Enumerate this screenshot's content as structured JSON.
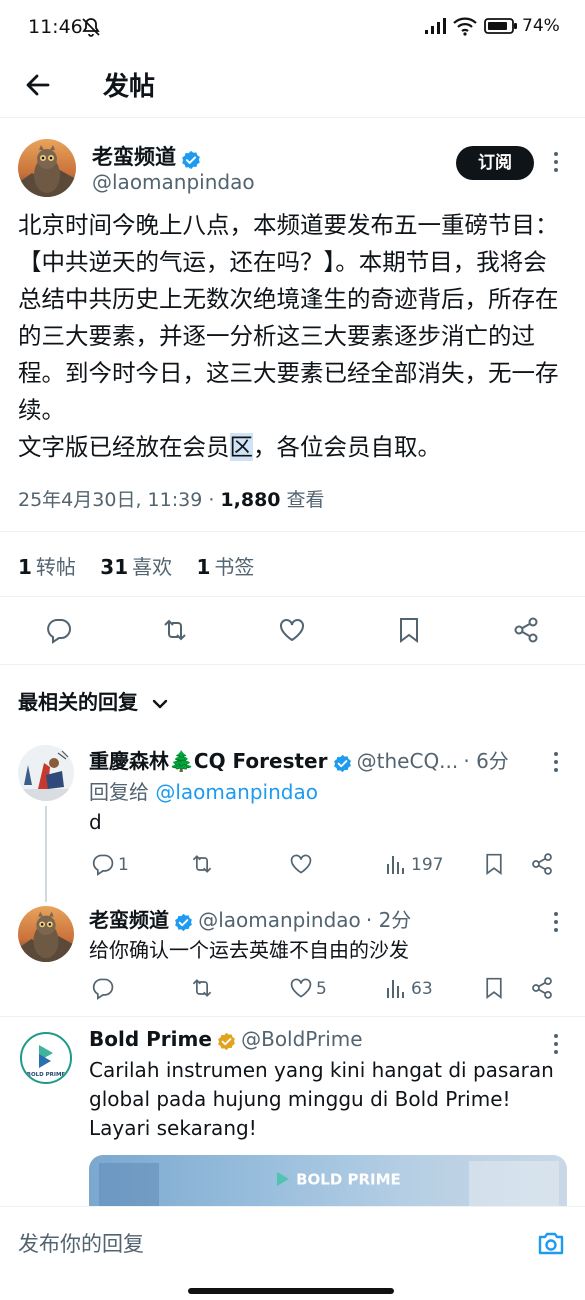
{
  "status_bar": {
    "time": "11:46",
    "battery": "74%"
  },
  "header": {
    "title": "发帖"
  },
  "post": {
    "author_name": "老蛮频道",
    "author_handle": "@laomanpindao",
    "subscribe_label": "订阅",
    "text_before_highlight": "北京时间今晚上八点，本频道要发布五一重磅节目：【中共逆天的气运，还在吗？】。本期节目，我将会总结中共历史上无数次绝境逢生的奇迹背后，所存在的三大要素，并逐一分析这三大要素逐步消亡的过程。到今时今日，这三大要素已经全部消失，无一存续。\n文字版已经放在会员",
    "highlighted": "区",
    "text_after_highlight": "，各位会员自取。",
    "timestamp": "25年4月30日, 11:39 · ",
    "views_count": "1,880",
    "views_label": " 查看",
    "stats": {
      "reposts_count": "1",
      "reposts_label": "转帖",
      "likes_count": "31",
      "likes_label": "喜欢",
      "bookmarks_count": "1",
      "bookmarks_label": "书签"
    }
  },
  "replies_filter": "最相关的回复",
  "replies": [
    {
      "name": "重慶森林🌲CQ Forester",
      "handle": "@theCQ...",
      "time": "· 6分",
      "reply_to_prefix": "回复给 ",
      "reply_to_handle": "@laomanpindao",
      "text": "d",
      "comments": "1",
      "reposts": "",
      "likes": "",
      "views": "197"
    },
    {
      "name": "老蛮频道",
      "handle": "@laomanpindao",
      "time": "· 2分",
      "text": "给你确认一个运去英雄不自由的沙发",
      "comments": "",
      "reposts": "",
      "likes": "5",
      "views": "63"
    }
  ],
  "ad": {
    "name": "Bold Prime",
    "handle": "@BoldPrime",
    "text": "Carilah instrumen yang kini hangat di pasaran global pada hujung minggu di Bold Prime! Layari sekarang!",
    "logo_text": "BOLD PRIME",
    "banner_text": "BOLD PRIME"
  },
  "compose": {
    "placeholder": "发布你的回复"
  },
  "colors": {
    "accent": "#1d9bf0",
    "text": "#0f1419",
    "secondary": "#536471"
  },
  "icons": [
    "back-arrow-icon",
    "verified-badge-icon",
    "reply-icon",
    "repost-icon",
    "like-icon",
    "bookmark-icon",
    "share-icon",
    "views-icon",
    "camera-icon",
    "chevron-down-icon"
  ]
}
